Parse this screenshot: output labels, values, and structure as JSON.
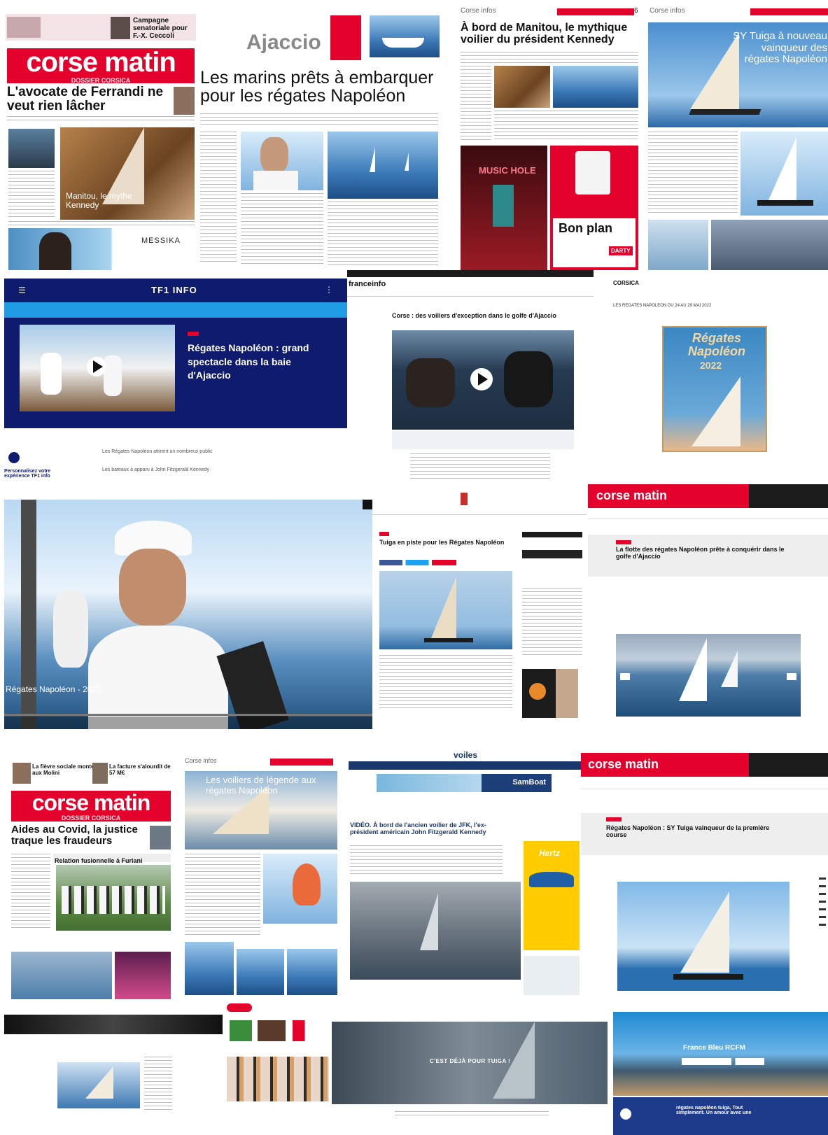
{
  "tile1": {
    "brand_top": "corse matin",
    "brand_sub": "DOSSIER CORSICA",
    "promo_top": "Campagne senatoriale pour F.-X. Ceccoli",
    "headline": "L'avocate de Ferrandi ne veut rien lâcher",
    "photo_caption": "Manitou, le mythe Kennedy",
    "ad_brand": "MESSIKA"
  },
  "tile2": {
    "section": "Ajaccio",
    "headline": "Les marins prêts à embarquer pour les régates Napoléon"
  },
  "tile3": {
    "section": "Corse infos",
    "page_num": "6",
    "headline": "À bord de Manitou, le mythique voilier du président Kennedy",
    "ad_music": "MUSIC HOLE",
    "ad_bon": "Bon plan",
    "ad_darty": "DARTY"
  },
  "tile4": {
    "section": "Corse infos",
    "headline": "SY Tuiga à nouveau vainqueur des régates Napoléon"
  },
  "tile5": {
    "brand": "TF1 INFO",
    "title": "Régates Napoléon : grand spectacle dans la baie d'Ajaccio",
    "bullet1": "Les Régates Napoléon attirent un nombreux public",
    "bullet2": "Les bateaux à apparu à John Fitzgerald Kennedy",
    "personalize": "Personnalisez votre expérience TF1 info"
  },
  "tile6": {
    "brand": "franceinfo",
    "title": "Corse : des voiliers d'exception dans le golfe d'Ajaccio"
  },
  "tile7": {
    "brand": "CORSICA",
    "header": "LES REGATES NAPOLEON DU 24 AU 29 MAI 2022",
    "poster_title": "Régates Napoléon",
    "poster_year": "2022"
  },
  "tile8": {
    "overlay": "Régates Napoléon - 2022"
  },
  "tile9": {
    "title": "Tuiga en piste pour les Régates Napoléon"
  },
  "tile10": {
    "brand": "corse matin",
    "headline": "La flotte des régates Napoléon prête à conquérir dans le golfe d'Ajaccio"
  },
  "tile11": {
    "brand_top": "corse matin",
    "brand_sub": "DOSSIER CORSICA",
    "promo1": "La fièvre sociale monte aux Molini",
    "promo2": "La facture s'alourdit de 57 M€",
    "headline": "Aides au Covid, la justice traque les fraudeurs",
    "subhead": "Relation fusionnelle à Furiani"
  },
  "tile12": {
    "section": "Corse infos",
    "headline": "Les voiliers de légende aux régates Napoléon"
  },
  "tile13": {
    "brand": "voiles",
    "ad": "SamBoat",
    "title": "VIDÉO. À bord de l'ancien voilier de JFK, l'ex-président américain John Fitzgerald Kennedy",
    "ad_side": "Hertz"
  },
  "tile14": {
    "brand": "corse matin",
    "headline": "Régates Napoléon : SY Tuiga vainqueur de la première course"
  },
  "tile17": {
    "overlay": "C'EST DÉJÀ POUR TUIGA !"
  },
  "tile18": {
    "brand": "France Bleu RCFM",
    "search_text": "régates napoléon tuiga, Tout simplement. Un amour avec une"
  },
  "colors": {
    "corse_red": "#e4022d",
    "tf1_navy": "#0f1c6e",
    "tf1_cyan": "#1f9ce4",
    "voiles_navy": "#19386e"
  }
}
